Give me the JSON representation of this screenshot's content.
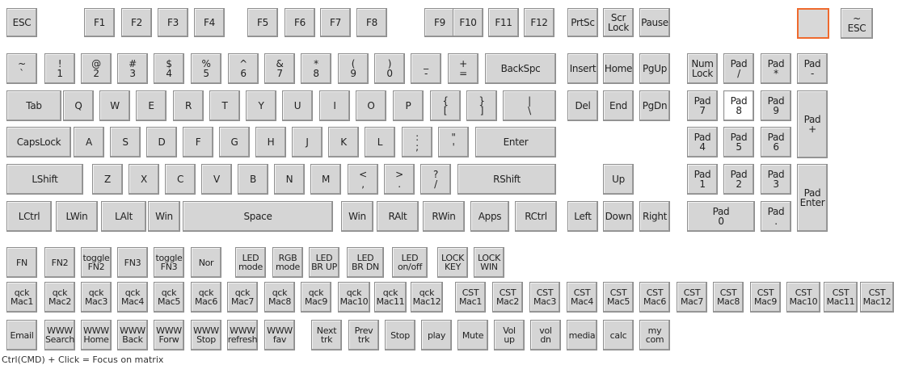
{
  "keyboard": {
    "selected_color": "#ffffff",
    "highlight_color": "#ef6a2e",
    "rows": [
      {
        "keys": [
          [
            "ESC"
          ],
          [
            "F1"
          ],
          [
            "F2"
          ],
          [
            "F3"
          ],
          [
            "F4"
          ],
          [
            "F5"
          ],
          [
            "F6"
          ],
          [
            "F7"
          ],
          [
            "F8"
          ],
          [
            "F9"
          ],
          [
            "F10"
          ],
          [
            "F11"
          ],
          [
            "F12"
          ],
          [
            "PrtSc"
          ],
          [
            "Scr",
            "Lock"
          ],
          [
            "Pause"
          ],
          [
            ""
          ],
          [
            "~",
            "ESC"
          ]
        ]
      },
      {
        "keys": [
          [
            "~",
            "`"
          ],
          [
            "!",
            "1"
          ],
          [
            "@",
            "2"
          ],
          [
            "#",
            "3"
          ],
          [
            "$",
            "4"
          ],
          [
            "%",
            "5"
          ],
          [
            "^",
            "6"
          ],
          [
            "&",
            "7"
          ],
          [
            "*",
            "8"
          ],
          [
            "(",
            "9"
          ],
          [
            ")",
            "0"
          ],
          [
            "_",
            "-"
          ],
          [
            "+",
            "="
          ],
          [
            "BackSpc"
          ],
          [
            "Insert"
          ],
          [
            "Home"
          ],
          [
            "PgUp"
          ],
          [
            "Num",
            "Lock"
          ],
          [
            "Pad",
            "/"
          ],
          [
            "Pad",
            "*"
          ],
          [
            "Pad",
            "-"
          ]
        ]
      },
      {
        "keys": [
          [
            "Tab"
          ],
          [
            "Q"
          ],
          [
            "W"
          ],
          [
            "E"
          ],
          [
            "R"
          ],
          [
            "T"
          ],
          [
            "Y"
          ],
          [
            "U"
          ],
          [
            "I"
          ],
          [
            "O"
          ],
          [
            "P"
          ],
          [
            "{",
            "["
          ],
          [
            "}",
            "]"
          ],
          [
            "|",
            "\\"
          ],
          [
            "Del"
          ],
          [
            "End"
          ],
          [
            "PgDn"
          ],
          [
            "Pad",
            "7"
          ],
          [
            "Pad",
            "8"
          ],
          [
            "Pad",
            "9"
          ],
          [
            "Pad",
            "+"
          ]
        ]
      },
      {
        "keys": [
          [
            "CapsLock"
          ],
          [
            "A"
          ],
          [
            "S"
          ],
          [
            "D"
          ],
          [
            "F"
          ],
          [
            "G"
          ],
          [
            "H"
          ],
          [
            "J"
          ],
          [
            "K"
          ],
          [
            "L"
          ],
          [
            ":",
            ";"
          ],
          [
            "\"",
            "'"
          ],
          [
            "Enter"
          ],
          [
            "Pad",
            "4"
          ],
          [
            "Pad",
            "5"
          ],
          [
            "Pad",
            "6"
          ]
        ]
      },
      {
        "keys": [
          [
            "LShift"
          ],
          [
            "Z"
          ],
          [
            "X"
          ],
          [
            "C"
          ],
          [
            "V"
          ],
          [
            "B"
          ],
          [
            "N"
          ],
          [
            "M"
          ],
          [
            "<",
            ","
          ],
          [
            ">",
            "."
          ],
          [
            "?",
            "/"
          ],
          [
            "RShift"
          ],
          [
            "Up"
          ],
          [
            "Pad",
            "1"
          ],
          [
            "Pad",
            "2"
          ],
          [
            "Pad",
            "3"
          ],
          [
            "Pad",
            "Enter"
          ]
        ]
      },
      {
        "keys": [
          [
            "LCtrl"
          ],
          [
            "LWin"
          ],
          [
            "LAlt"
          ],
          [
            "Win"
          ],
          [
            "Space"
          ],
          [
            "Win"
          ],
          [
            "RAlt"
          ],
          [
            "RWin"
          ],
          [
            "Apps"
          ],
          [
            "RCtrl"
          ],
          [
            "Left"
          ],
          [
            "Down"
          ],
          [
            "Right"
          ],
          [
            "Pad",
            "0"
          ],
          [
            "Pad",
            "."
          ]
        ]
      },
      {
        "keys": [
          [
            "FN"
          ],
          [
            "FN2"
          ],
          [
            "toggle",
            "FN2"
          ],
          [
            "FN3"
          ],
          [
            "toggle",
            "FN3"
          ],
          [
            "Nor"
          ],
          [
            "LED",
            "mode"
          ],
          [
            "RGB",
            "mode"
          ],
          [
            "LED",
            "BR UP"
          ],
          [
            "LED",
            "BR DN"
          ],
          [
            "LED",
            "on/off"
          ],
          [
            "LOCK",
            "KEY"
          ],
          [
            "LOCK",
            "WIN"
          ]
        ]
      },
      {
        "keys": [
          [
            "qck",
            "Mac1"
          ],
          [
            "qck",
            "Mac2"
          ],
          [
            "qck",
            "Mac3"
          ],
          [
            "qck",
            "Mac4"
          ],
          [
            "qck",
            "Mac5"
          ],
          [
            "qck",
            "Mac6"
          ],
          [
            "qck",
            "Mac7"
          ],
          [
            "qck",
            "Mac8"
          ],
          [
            "qck",
            "Mac9"
          ],
          [
            "qck",
            "Mac10"
          ],
          [
            "qck",
            "Mac11"
          ],
          [
            "qck",
            "Mac12"
          ],
          [
            "CST",
            "Mac1"
          ],
          [
            "CST",
            "Mac2"
          ],
          [
            "CST",
            "Mac3"
          ],
          [
            "CST",
            "Mac4"
          ],
          [
            "CST",
            "Mac5"
          ],
          [
            "CST",
            "Mac6"
          ],
          [
            "CST",
            "Mac7"
          ],
          [
            "CST",
            "Mac8"
          ],
          [
            "CST",
            "Mac9"
          ],
          [
            "CST",
            "Mac10"
          ],
          [
            "CST",
            "Mac11"
          ],
          [
            "CST",
            "Mac12"
          ]
        ]
      },
      {
        "keys": [
          [
            "Email"
          ],
          [
            "WWW",
            "Search"
          ],
          [
            "WWW",
            "Home"
          ],
          [
            "WWW",
            "Back"
          ],
          [
            "WWW",
            "Forw"
          ],
          [
            "WWW",
            "Stop"
          ],
          [
            "WWW",
            "refresh"
          ],
          [
            "WWW",
            "fav"
          ],
          [
            "Next",
            "trk"
          ],
          [
            "Prev",
            "trk"
          ],
          [
            "Stop"
          ],
          [
            "play"
          ],
          [
            "Mute"
          ],
          [
            "Vol",
            "up"
          ],
          [
            "vol",
            "dn"
          ],
          [
            "media"
          ],
          [
            "calc"
          ],
          [
            "my",
            "com"
          ]
        ]
      }
    ],
    "selected_key": "Pad 8",
    "highlighted_key": "empty key"
  },
  "footer": {
    "hint": "Ctrl(CMD) + Click = Focus on matrix"
  }
}
